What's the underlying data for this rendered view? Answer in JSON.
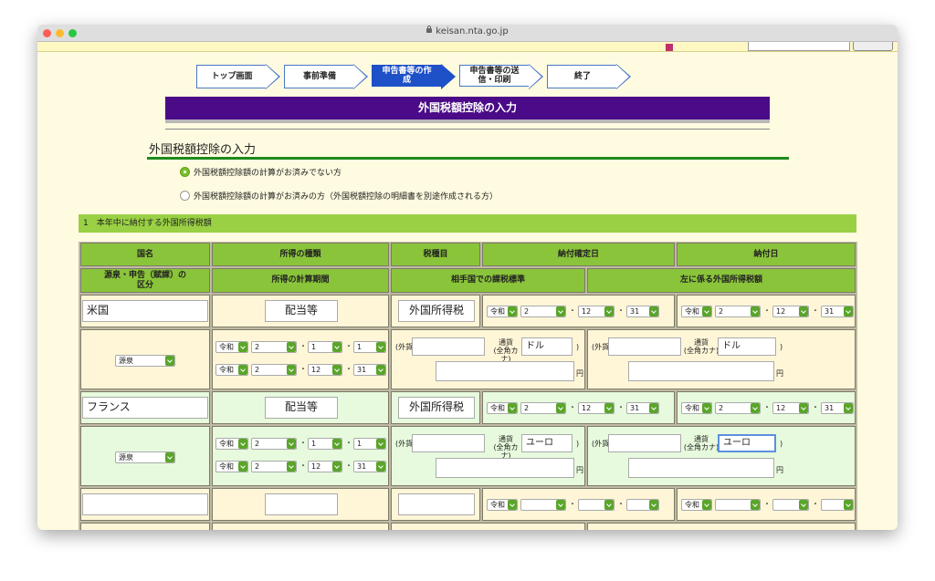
{
  "browser": {
    "url": "keisan.nta.go.jp"
  },
  "steps": [
    {
      "label": "トップ画面"
    },
    {
      "label": "事前準備"
    },
    {
      "label": "申告書等の作成"
    },
    {
      "label": "申告書等の送信・印刷"
    },
    {
      "label": "終了"
    }
  ],
  "page_header": "外国税額控除の入力",
  "section_title": "外国税額控除の入力",
  "radio_options": [
    {
      "label": "外国税額控除額の計算がお済みでない方",
      "selected": true
    },
    {
      "label": "外国税額控除額の計算がお済みの方（外国税額控除の明細書を別途作成される方）",
      "selected": false
    }
  ],
  "band_title": "1　本年中に納付する外国所得税額",
  "table": {
    "headers_row1": [
      "国名",
      "所得の種類",
      "税種目",
      "納付確定日",
      "納付日"
    ],
    "headers_row2": [
      "源泉・申告（賦課）の区分",
      "所得の計算期間",
      "相手国での課税標準",
      "左に係る外国所得税額"
    ],
    "labels": {
      "foreign": "(外貨",
      "currency": "通貨",
      "katakana": "(全角カナ)",
      "close": ")",
      "yen": "円",
      "dot": "・"
    },
    "era": "令和",
    "rows": [
      {
        "country": "米国",
        "income_type": "配当等",
        "tax_type": "外国所得税",
        "confirm_date": [
          "2",
          "12",
          "31"
        ],
        "pay_date": [
          "2",
          "12",
          "31"
        ],
        "division": "源泉",
        "period_from": [
          "2",
          "1",
          "1"
        ],
        "period_to": [
          "2",
          "12",
          "31"
        ],
        "currency1": "ドル",
        "currency2": "ドル"
      },
      {
        "country": "フランス",
        "income_type": "配当等",
        "tax_type": "外国所得税",
        "confirm_date": [
          "2",
          "12",
          "31"
        ],
        "pay_date": [
          "2",
          "12",
          "31"
        ],
        "division": "源泉",
        "period_from": [
          "2",
          "1",
          "1"
        ],
        "period_to": [
          "2",
          "12",
          "31"
        ],
        "currency1": "ユーロ",
        "currency2": "ユーロ"
      },
      {
        "country": "",
        "income_type": "",
        "tax_type": "",
        "confirm_date": [
          "",
          "",
          ""
        ],
        "pay_date": [
          "",
          "",
          ""
        ]
      }
    ]
  }
}
